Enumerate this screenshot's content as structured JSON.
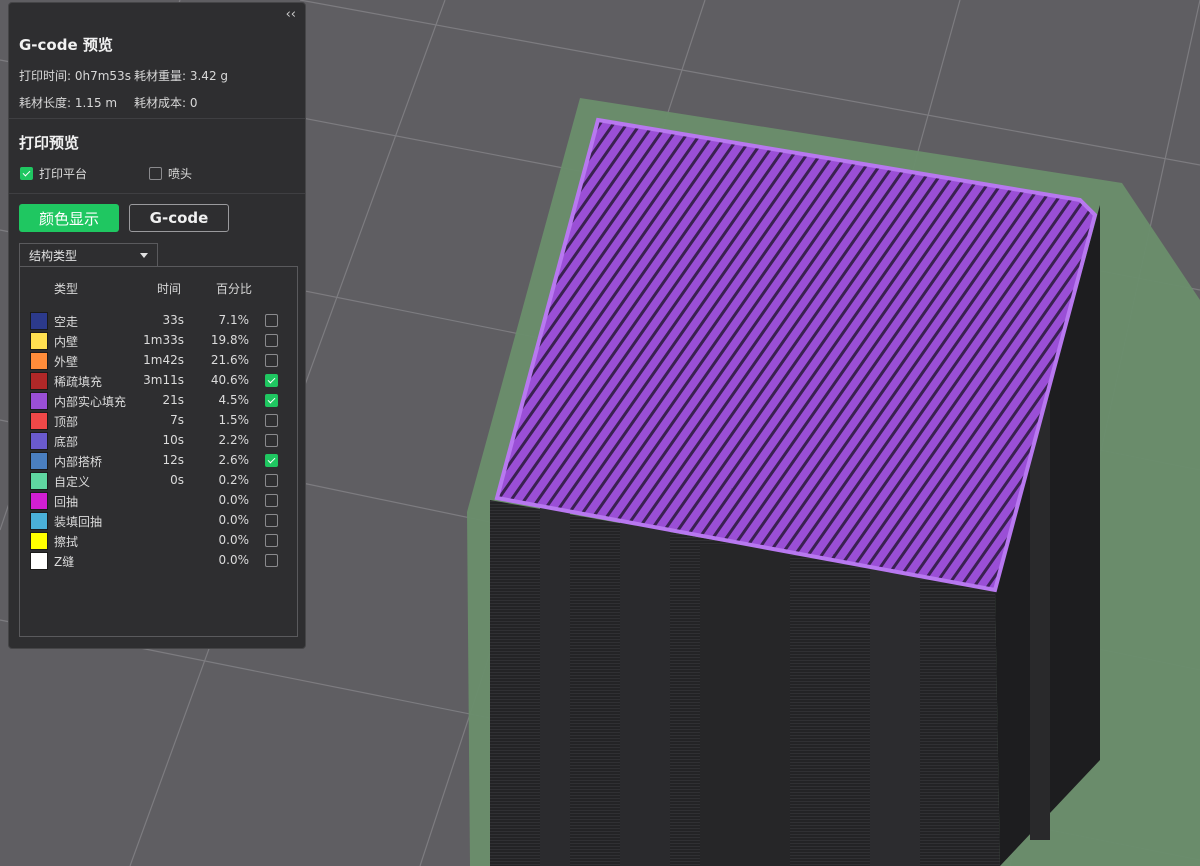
{
  "panel": {
    "collapse_label": "‹‹",
    "title": "G-code 预览",
    "stats": {
      "print_time": "打印时间: 0h7m53s",
      "filament_weight": "耗材重量: 3.42 g",
      "filament_length": "耗材长度: 1.15 m",
      "filament_cost": "耗材成本: 0"
    },
    "preview_section": {
      "title": "打印预览",
      "build_plate": {
        "label": "打印平台",
        "checked": true
      },
      "nozzle": {
        "label": "喷头",
        "checked": false
      }
    },
    "buttons": {
      "color_display": "颜色显示",
      "gcode": "G-code"
    },
    "dropdown": {
      "selected": "结构类型"
    },
    "legend": {
      "headers": {
        "type": "类型",
        "time": "时间",
        "percent": "百分比"
      },
      "rows": [
        {
          "name": "空走",
          "time": "33s",
          "percent": "7.1%",
          "color": "#2c3a8c",
          "checked": false
        },
        {
          "name": "内壁",
          "time": "1m33s",
          "percent": "19.8%",
          "color": "#ffe050",
          "checked": false
        },
        {
          "name": "外壁",
          "time": "1m42s",
          "percent": "21.6%",
          "color": "#ff8c3a",
          "checked": false
        },
        {
          "name": "稀疏填充",
          "time": "3m11s",
          "percent": "40.6%",
          "color": "#b02828",
          "checked": true
        },
        {
          "name": "内部实心填充",
          "time": "21s",
          "percent": "4.5%",
          "color": "#9a4fd6",
          "checked": true
        },
        {
          "name": "顶部",
          "time": "7s",
          "percent": "1.5%",
          "color": "#f04848",
          "checked": false
        },
        {
          "name": "底部",
          "time": "10s",
          "percent": "2.2%",
          "color": "#6a5acd",
          "checked": false
        },
        {
          "name": "内部搭桥",
          "time": "12s",
          "percent": "2.6%",
          "color": "#4a7fc0",
          "checked": true
        },
        {
          "name": "自定义",
          "time": "0s",
          "percent": "0.2%",
          "color": "#5fd6a0",
          "checked": false
        },
        {
          "name": "回抽",
          "time": "",
          "percent": "0.0%",
          "color": "#d21ed2",
          "checked": false
        },
        {
          "name": "装填回抽",
          "time": "",
          "percent": "0.0%",
          "color": "#4ab0d8",
          "checked": false
        },
        {
          "name": "擦拭",
          "time": "",
          "percent": "0.0%",
          "color": "#ffff00",
          "checked": false
        },
        {
          "name": "Z缝",
          "time": "",
          "percent": "0.0%",
          "color": "#ffffff",
          "checked": false
        }
      ]
    }
  },
  "viewport": {
    "background": "#5f5e62",
    "grid_color": "#7d7c80",
    "plate_color": "#6a8e6c",
    "top_color": "#9a4fd6",
    "wall_color": "#1f1f21"
  }
}
